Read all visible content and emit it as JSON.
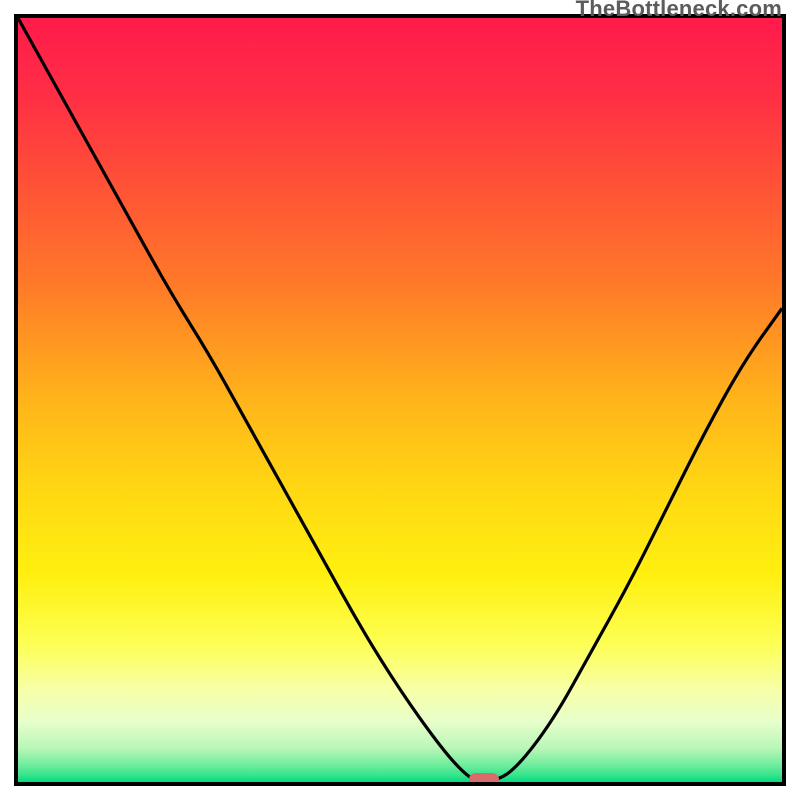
{
  "watermark": "TheBottleneck.com",
  "colors": {
    "border": "#000000",
    "curve": "#000000",
    "marker": "#d96b6b",
    "gradient_stops": [
      {
        "offset": 0.0,
        "color": "#ff1b4b"
      },
      {
        "offset": 0.1,
        "color": "#ff2e45"
      },
      {
        "offset": 0.22,
        "color": "#ff5236"
      },
      {
        "offset": 0.35,
        "color": "#ff7a28"
      },
      {
        "offset": 0.5,
        "color": "#ffb41a"
      },
      {
        "offset": 0.62,
        "color": "#ffd813"
      },
      {
        "offset": 0.73,
        "color": "#fff010"
      },
      {
        "offset": 0.82,
        "color": "#fdff55"
      },
      {
        "offset": 0.88,
        "color": "#f7ffa8"
      },
      {
        "offset": 0.92,
        "color": "#e8ffca"
      },
      {
        "offset": 0.955,
        "color": "#baf7b8"
      },
      {
        "offset": 0.975,
        "color": "#7aeea0"
      },
      {
        "offset": 0.99,
        "color": "#3be58f"
      },
      {
        "offset": 0.996,
        "color": "#18df84"
      },
      {
        "offset": 1.0,
        "color": "#00db7c"
      }
    ]
  },
  "chart_data": {
    "type": "line",
    "title": "",
    "xlabel": "",
    "ylabel": "",
    "xlim": [
      0,
      100
    ],
    "ylim": [
      0,
      100
    ],
    "x": [
      0,
      5,
      10,
      15,
      20,
      25,
      30,
      35,
      40,
      45,
      50,
      55,
      58,
      60,
      62,
      65,
      70,
      75,
      80,
      85,
      90,
      95,
      100
    ],
    "values": [
      100,
      91,
      82,
      73,
      64,
      56,
      47,
      38,
      29,
      20,
      12,
      5,
      1.5,
      0,
      0,
      1.5,
      8,
      17,
      26,
      36,
      46,
      55,
      62
    ],
    "marker": {
      "x": 61,
      "y": 0.3
    },
    "grid": false,
    "legend": false
  }
}
